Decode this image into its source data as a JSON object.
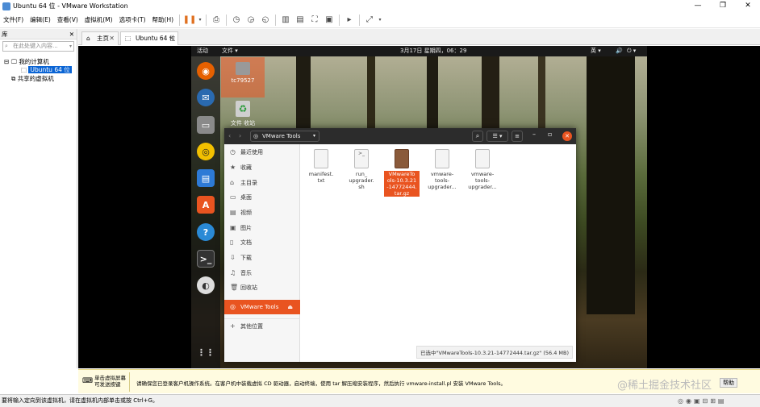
{
  "window": {
    "title": "Ubuntu 64 位 - VMware Workstation"
  },
  "menu": [
    "文件(F)",
    "编辑(E)",
    "查看(V)",
    "虚拟机(M)",
    "选项卡(T)",
    "帮助(H)"
  ],
  "library": {
    "header": "库",
    "search_placeholder": "在此处键入内容...",
    "my_computer": "我的计算机",
    "vm_name": "Ubuntu 64 位",
    "shared": "共享的虚拟机"
  },
  "tabs": {
    "home": "主页",
    "vm": "Ubuntu 64 位"
  },
  "ubuntu": {
    "activities": "活动",
    "files_menu": "文件 ▾",
    "clock": "3月17日 星期四，06：29",
    "lang": "英 ▾",
    "desktop_icons": [
      "tc79527",
      "文件 收站"
    ],
    "nautilus": {
      "path": "VMware Tools",
      "sidebar": [
        "最近使用",
        "收藏",
        "主目录",
        "桌面",
        "视频",
        "图片",
        "文档",
        "下载",
        "音乐",
        "回收站",
        "VMware Tools",
        "其他位置"
      ],
      "files": [
        {
          "name": "manifest.\ntxt"
        },
        {
          "name": "run_\nupgrader.\nsh"
        },
        {
          "name": "VMwareTo\nols-10.3.21\n-14772444.\ntar.gz"
        },
        {
          "name": "vmware-\ntools-\nupgrader..."
        },
        {
          "name": "vmware-\ntools-\nupgrader..."
        }
      ],
      "status": "已选中\"VMwareTools-10.3.21-14772444.tar.gz\" (56.4 MB)"
    }
  },
  "hint": {
    "left": "单击虚拟屏幕\n可发送按键",
    "message": "请确保您已登录客户机操作系统。在客户机中装载虚拟 CD 驱动器，启动终端，使用 tar 解压缩安装程序，然后执行 vmware-install.pl 安装 VMware Tools。",
    "watermark": "@稀土掘金技术社区",
    "help": "帮助"
  },
  "statusbar": "要将输入定向到该虚拟机，请在虚拟机内部单击或按 Ctrl+G。",
  "colors": {
    "selection": "#e95420",
    "dock": "#1a1a1a",
    "hintbg": "#fffbe0"
  }
}
